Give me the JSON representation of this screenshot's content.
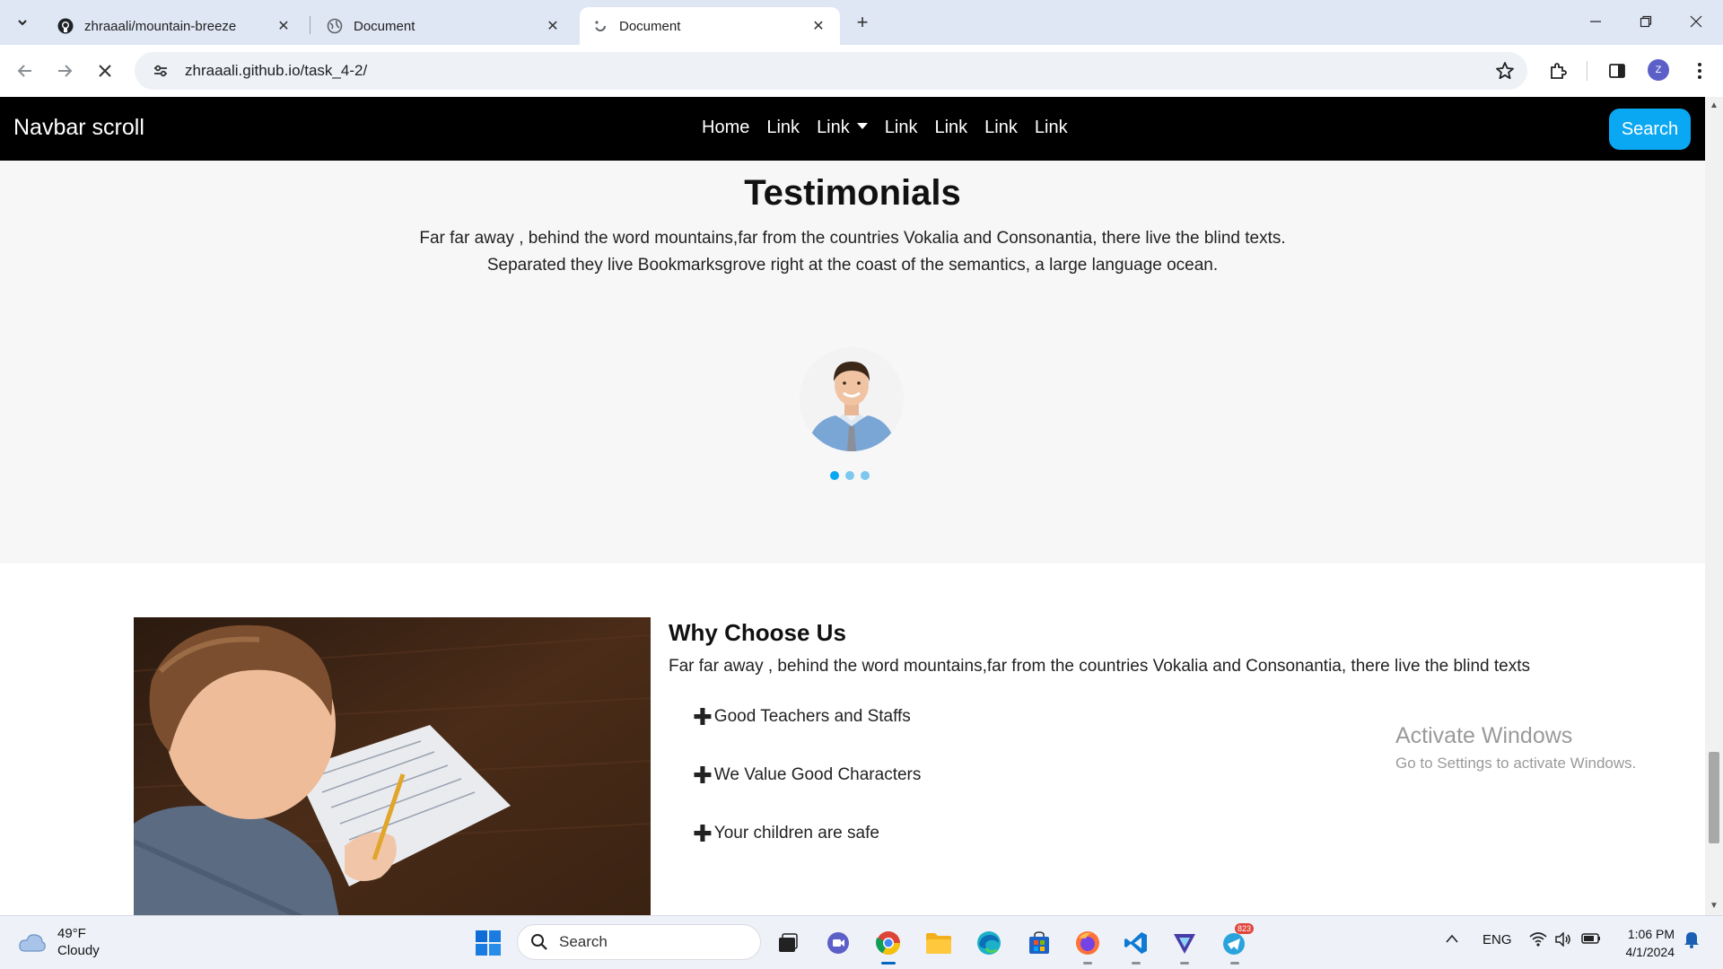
{
  "browser": {
    "tabs": [
      {
        "title": "zhraaali/mountain-breeze",
        "icon": "github-icon",
        "active": false
      },
      {
        "title": "Document",
        "icon": "globe-icon",
        "active": false
      },
      {
        "title": "Document",
        "icon": "loading-icon",
        "active": true
      }
    ],
    "url": "zhraaali.github.io/task_4-2/",
    "profile_initial": "Z"
  },
  "page": {
    "navbar": {
      "brand": "Navbar scroll",
      "links": [
        "Home",
        "Link",
        "Link",
        "Link",
        "Link",
        "Link",
        "Link"
      ],
      "dropdown_index": 2,
      "search_label": "Search"
    },
    "testimonials": {
      "title": "Testimonials",
      "text": "Far far away , behind the word mountains,far from the countries Vokalia and Consonantia, there live the blind texts. Separated they live Bookmarksgrove right at the coast of the semantics, a large language ocean.",
      "carousel_dots": 3,
      "active_dot": 1
    },
    "why": {
      "title": "Why Choose Us",
      "text": "Far far away , behind the word mountains,far from the countries Vokalia and Consonantia, there live the blind texts",
      "items": [
        "Good Teachers and Staffs",
        "We Value Good Characters",
        "Your children are safe"
      ]
    },
    "watermark": {
      "line1": "Activate Windows",
      "line2": "Go to Settings to activate Windows."
    }
  },
  "taskbar": {
    "weather_temp": "49°F",
    "weather_desc": "Cloudy",
    "search_label": "Search",
    "apps": [
      "file-explorer-dark-icon",
      "meet-icon",
      "chrome-icon",
      "folder-icon",
      "edge-icon",
      "store-icon",
      "firefox-icon",
      "vscode-icon",
      "vpn-icon",
      "telegram-icon"
    ],
    "telegram_badge": "823",
    "language": "ENG",
    "time": "1:06 PM",
    "date": "4/1/2024"
  }
}
